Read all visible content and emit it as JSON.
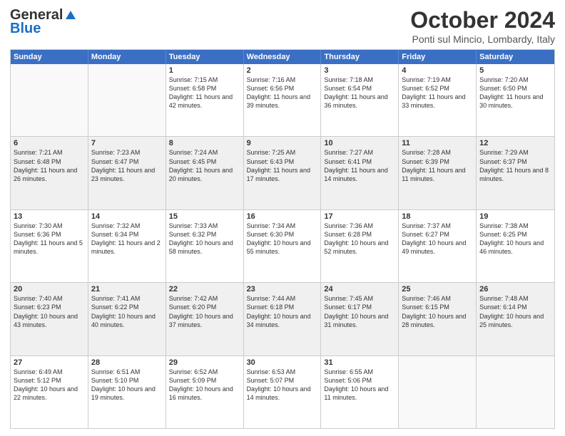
{
  "logo": {
    "general": "General",
    "blue": "Blue"
  },
  "header": {
    "month": "October 2024",
    "location": "Ponti sul Mincio, Lombardy, Italy"
  },
  "weekdays": [
    "Sunday",
    "Monday",
    "Tuesday",
    "Wednesday",
    "Thursday",
    "Friday",
    "Saturday"
  ],
  "rows": [
    [
      {
        "day": "",
        "info": ""
      },
      {
        "day": "",
        "info": ""
      },
      {
        "day": "1",
        "info": "Sunrise: 7:15 AM\nSunset: 6:58 PM\nDaylight: 11 hours and 42 minutes."
      },
      {
        "day": "2",
        "info": "Sunrise: 7:16 AM\nSunset: 6:56 PM\nDaylight: 11 hours and 39 minutes."
      },
      {
        "day": "3",
        "info": "Sunrise: 7:18 AM\nSunset: 6:54 PM\nDaylight: 11 hours and 36 minutes."
      },
      {
        "day": "4",
        "info": "Sunrise: 7:19 AM\nSunset: 6:52 PM\nDaylight: 11 hours and 33 minutes."
      },
      {
        "day": "5",
        "info": "Sunrise: 7:20 AM\nSunset: 6:50 PM\nDaylight: 11 hours and 30 minutes."
      }
    ],
    [
      {
        "day": "6",
        "info": "Sunrise: 7:21 AM\nSunset: 6:48 PM\nDaylight: 11 hours and 26 minutes."
      },
      {
        "day": "7",
        "info": "Sunrise: 7:23 AM\nSunset: 6:47 PM\nDaylight: 11 hours and 23 minutes."
      },
      {
        "day": "8",
        "info": "Sunrise: 7:24 AM\nSunset: 6:45 PM\nDaylight: 11 hours and 20 minutes."
      },
      {
        "day": "9",
        "info": "Sunrise: 7:25 AM\nSunset: 6:43 PM\nDaylight: 11 hours and 17 minutes."
      },
      {
        "day": "10",
        "info": "Sunrise: 7:27 AM\nSunset: 6:41 PM\nDaylight: 11 hours and 14 minutes."
      },
      {
        "day": "11",
        "info": "Sunrise: 7:28 AM\nSunset: 6:39 PM\nDaylight: 11 hours and 11 minutes."
      },
      {
        "day": "12",
        "info": "Sunrise: 7:29 AM\nSunset: 6:37 PM\nDaylight: 11 hours and 8 minutes."
      }
    ],
    [
      {
        "day": "13",
        "info": "Sunrise: 7:30 AM\nSunset: 6:36 PM\nDaylight: 11 hours and 5 minutes."
      },
      {
        "day": "14",
        "info": "Sunrise: 7:32 AM\nSunset: 6:34 PM\nDaylight: 11 hours and 2 minutes."
      },
      {
        "day": "15",
        "info": "Sunrise: 7:33 AM\nSunset: 6:32 PM\nDaylight: 10 hours and 58 minutes."
      },
      {
        "day": "16",
        "info": "Sunrise: 7:34 AM\nSunset: 6:30 PM\nDaylight: 10 hours and 55 minutes."
      },
      {
        "day": "17",
        "info": "Sunrise: 7:36 AM\nSunset: 6:28 PM\nDaylight: 10 hours and 52 minutes."
      },
      {
        "day": "18",
        "info": "Sunrise: 7:37 AM\nSunset: 6:27 PM\nDaylight: 10 hours and 49 minutes."
      },
      {
        "day": "19",
        "info": "Sunrise: 7:38 AM\nSunset: 6:25 PM\nDaylight: 10 hours and 46 minutes."
      }
    ],
    [
      {
        "day": "20",
        "info": "Sunrise: 7:40 AM\nSunset: 6:23 PM\nDaylight: 10 hours and 43 minutes."
      },
      {
        "day": "21",
        "info": "Sunrise: 7:41 AM\nSunset: 6:22 PM\nDaylight: 10 hours and 40 minutes."
      },
      {
        "day": "22",
        "info": "Sunrise: 7:42 AM\nSunset: 6:20 PM\nDaylight: 10 hours and 37 minutes."
      },
      {
        "day": "23",
        "info": "Sunrise: 7:44 AM\nSunset: 6:18 PM\nDaylight: 10 hours and 34 minutes."
      },
      {
        "day": "24",
        "info": "Sunrise: 7:45 AM\nSunset: 6:17 PM\nDaylight: 10 hours and 31 minutes."
      },
      {
        "day": "25",
        "info": "Sunrise: 7:46 AM\nSunset: 6:15 PM\nDaylight: 10 hours and 28 minutes."
      },
      {
        "day": "26",
        "info": "Sunrise: 7:48 AM\nSunset: 6:14 PM\nDaylight: 10 hours and 25 minutes."
      }
    ],
    [
      {
        "day": "27",
        "info": "Sunrise: 6:49 AM\nSunset: 5:12 PM\nDaylight: 10 hours and 22 minutes."
      },
      {
        "day": "28",
        "info": "Sunrise: 6:51 AM\nSunset: 5:10 PM\nDaylight: 10 hours and 19 minutes."
      },
      {
        "day": "29",
        "info": "Sunrise: 6:52 AM\nSunset: 5:09 PM\nDaylight: 10 hours and 16 minutes."
      },
      {
        "day": "30",
        "info": "Sunrise: 6:53 AM\nSunset: 5:07 PM\nDaylight: 10 hours and 14 minutes."
      },
      {
        "day": "31",
        "info": "Sunrise: 6:55 AM\nSunset: 5:06 PM\nDaylight: 10 hours and 11 minutes."
      },
      {
        "day": "",
        "info": ""
      },
      {
        "day": "",
        "info": ""
      }
    ]
  ]
}
